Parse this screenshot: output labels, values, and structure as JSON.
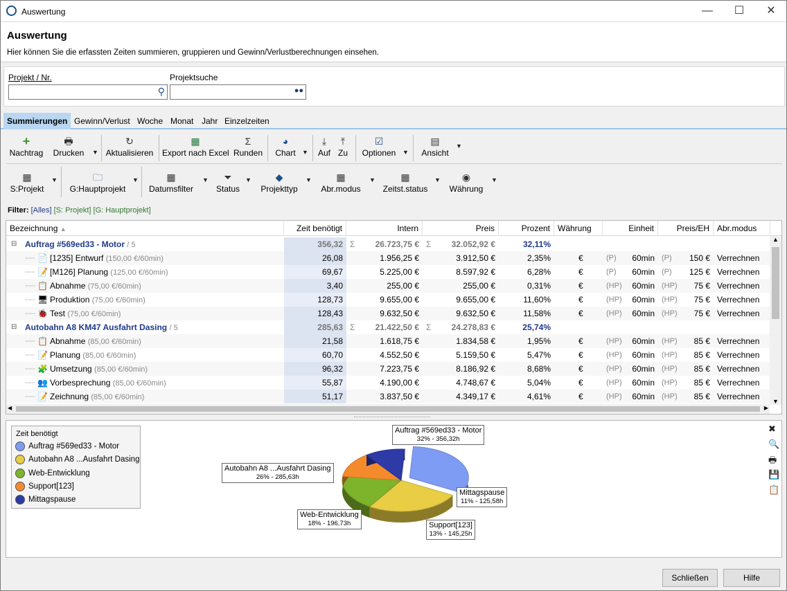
{
  "window": {
    "title": "Auswertung",
    "minimize": "—",
    "maximize": "☐",
    "close": "✕"
  },
  "header": {
    "title": "Auswertung",
    "subtitle": "Hier können Sie die erfassten Zeiten summieren, gruppieren und Gewinn/Verlustberechnungen einsehen."
  },
  "search": {
    "project_label": "Projekt / Nr.",
    "project_value": "",
    "search_label": "Projektsuche",
    "search_value": ""
  },
  "tabs": [
    "Summierungen",
    "Gewinn/Verlust",
    "Woche",
    "Monat",
    "Jahr",
    "Einzelzeiten"
  ],
  "toolbar1": {
    "nachtrag": "Nachtrag",
    "drucken": "Drucken",
    "aktualisieren": "Aktualisieren",
    "export": "Export nach Excel",
    "runden": "Runden",
    "chart": "Chart",
    "auf": "Auf",
    "zu": "Zu",
    "optionen": "Optionen",
    "ansicht": "Ansicht"
  },
  "toolbar2": {
    "sprojekt": "S:Projekt",
    "ghauptprojekt": "G:Hauptprojekt",
    "datumsfilter": "Datumsfilter",
    "status": "Status",
    "projekttyp": "Projekttyp",
    "abrmodus": "Abr.modus",
    "zeitststatus": "Zeitst.status",
    "waehrung": "Währung"
  },
  "filter": {
    "label": "Filter:",
    "all": "[Alles]",
    "s": "[S: Projekt]",
    "g": "[G: Hauptprojekt]"
  },
  "columns": [
    "Bezeichnung",
    "Zeit benötigt",
    "Intern",
    "Preis",
    "Prozent",
    "Währung",
    "Einheit",
    "Preis/EH",
    "Abr.modus"
  ],
  "groups": [
    {
      "name": "Auftrag #569ed33 - Motor",
      "count": "/ 5",
      "zeit": "356,32",
      "intern": "26.723,75 €",
      "preis": "32.052,92 €",
      "prozent": "32,11%",
      "rows": [
        {
          "name": "[1235] Entwurf",
          "rate": "(150,00 €/60min)",
          "zeit": "26,08",
          "intern": "1.956,25 €",
          "preis": "3.912,50 €",
          "prozent": "2,35%",
          "waehrung": "€",
          "tag1": "(P)",
          "einheit": "60min",
          "tag2": "(P)",
          "preiseh": "150 €",
          "abr": "Verrechnen",
          "icon": "document-icon",
          "ic": "📄"
        },
        {
          "name": "[M126] Planung",
          "rate": "(125,00 €/60min)",
          "zeit": "69,67",
          "intern": "5.225,00 €",
          "preis": "8.597,92 €",
          "prozent": "6,28%",
          "waehrung": "€",
          "tag1": "(P)",
          "einheit": "60min",
          "tag2": "(P)",
          "preiseh": "125 €",
          "abr": "Verrechnen",
          "icon": "pencil-icon",
          "ic": "📝"
        },
        {
          "name": "Abnahme",
          "rate": "(75,00 €/60min)",
          "zeit": "3,40",
          "intern": "255,00 €",
          "preis": "255,00 €",
          "prozent": "0,31%",
          "waehrung": "€",
          "tag1": "(HP)",
          "einheit": "60min",
          "tag2": "(HP)",
          "preiseh": "75 €",
          "abr": "Verrechnen",
          "icon": "clipboard-icon",
          "ic": "📋"
        },
        {
          "name": "Produktion",
          "rate": "(75,00 €/60min)",
          "zeit": "128,73",
          "intern": "9.655,00 €",
          "preis": "9.655,00 €",
          "prozent": "11,60%",
          "waehrung": "€",
          "tag1": "(HP)",
          "einheit": "60min",
          "tag2": "(HP)",
          "preiseh": "75 €",
          "abr": "Verrechnen",
          "icon": "monitor-icon",
          "ic": "🖥"
        },
        {
          "name": "Test",
          "rate": "(75,00 €/60min)",
          "zeit": "128,43",
          "intern": "9.632,50 €",
          "preis": "9.632,50 €",
          "prozent": "11,58%",
          "waehrung": "€",
          "tag1": "(HP)",
          "einheit": "60min",
          "tag2": "(HP)",
          "preiseh": "75 €",
          "abr": "Verrechnen",
          "icon": "bug-icon",
          "ic": "🐞"
        }
      ]
    },
    {
      "name": "Autobahn A8 KM47 Ausfahrt Dasing",
      "count": "/ 5",
      "zeit": "285,63",
      "intern": "21.422,50 €",
      "preis": "24.278,83 €",
      "prozent": "25,74%",
      "rows": [
        {
          "name": "Abnahme",
          "rate": "(85,00 €/60min)",
          "zeit": "21,58",
          "intern": "1.618,75 €",
          "preis": "1.834,58 €",
          "prozent": "1,95%",
          "waehrung": "€",
          "tag1": "(HP)",
          "einheit": "60min",
          "tag2": "(HP)",
          "preiseh": "85 €",
          "abr": "Verrechnen",
          "icon": "clipboard-icon",
          "ic": "📋"
        },
        {
          "name": "Planung",
          "rate": "(85,00 €/60min)",
          "zeit": "60,70",
          "intern": "4.552,50 €",
          "preis": "5.159,50 €",
          "prozent": "5,47%",
          "waehrung": "€",
          "tag1": "(HP)",
          "einheit": "60min",
          "tag2": "(HP)",
          "preiseh": "85 €",
          "abr": "Verrechnen",
          "icon": "pencil-icon",
          "ic": "📝"
        },
        {
          "name": "Umsetzung",
          "rate": "(85,00 €/60min)",
          "zeit": "96,32",
          "intern": "7.223,75 €",
          "preis": "8.186,92 €",
          "prozent": "8,68%",
          "waehrung": "€",
          "tag1": "(HP)",
          "einheit": "60min",
          "tag2": "(HP)",
          "preiseh": "85 €",
          "abr": "Verrechnen",
          "icon": "puzzle-icon",
          "ic": "🧩"
        },
        {
          "name": "Vorbesprechung",
          "rate": "(85,00 €/60min)",
          "zeit": "55,87",
          "intern": "4.190,00 €",
          "preis": "4.748,67 €",
          "prozent": "5,04%",
          "waehrung": "€",
          "tag1": "(HP)",
          "einheit": "60min",
          "tag2": "(HP)",
          "preiseh": "85 €",
          "abr": "Verrechnen",
          "icon": "people-icon",
          "ic": "👥"
        },
        {
          "name": "Zeichnung",
          "rate": "(85,00 €/60min)",
          "zeit": "51,17",
          "intern": "3.837,50 €",
          "preis": "4.349,17 €",
          "prozent": "4,61%",
          "waehrung": "€",
          "tag1": "(HP)",
          "einheit": "60min",
          "tag2": "(HP)",
          "preiseh": "85 €",
          "abr": "Verrechnen",
          "icon": "pencil-icon",
          "ic": "📝"
        }
      ]
    }
  ],
  "chart_data": {
    "type": "pie",
    "title": "Zeit benötigt",
    "series": [
      {
        "name": "Auftrag #569ed33 - Motor",
        "percent": 32,
        "value": "356,32h",
        "color": "#7f9cf5"
      },
      {
        "name": "Autobahn A8 ...Ausfahrt Dasing",
        "percent": 26,
        "value": "285,63h",
        "color": "#e8cd45"
      },
      {
        "name": "Web-Entwicklung",
        "percent": 18,
        "value": "196,73h",
        "color": "#7eb32c"
      },
      {
        "name": "Support[123]",
        "percent": 13,
        "value": "145,25h",
        "color": "#f58a2d"
      },
      {
        "name": "Mittagspause",
        "percent": 11,
        "value": "125,58h",
        "color": "#2e3ba6"
      }
    ],
    "callouts": [
      {
        "name": "Auftrag #569ed33 - Motor",
        "sub": "32% - 356,32h"
      },
      {
        "name": "Autobahn A8 ...Ausfahrt Dasing",
        "sub": "26% - 285,63h"
      },
      {
        "name": "Web-Entwicklung",
        "sub": "18% - 196,73h"
      },
      {
        "name": "Support[123]",
        "sub": "13% - 145,25h"
      },
      {
        "name": "Mittagspause",
        "sub": "11% - 125,58h"
      }
    ]
  },
  "buttons": {
    "close": "Schließen",
    "help": "Hilfe"
  }
}
